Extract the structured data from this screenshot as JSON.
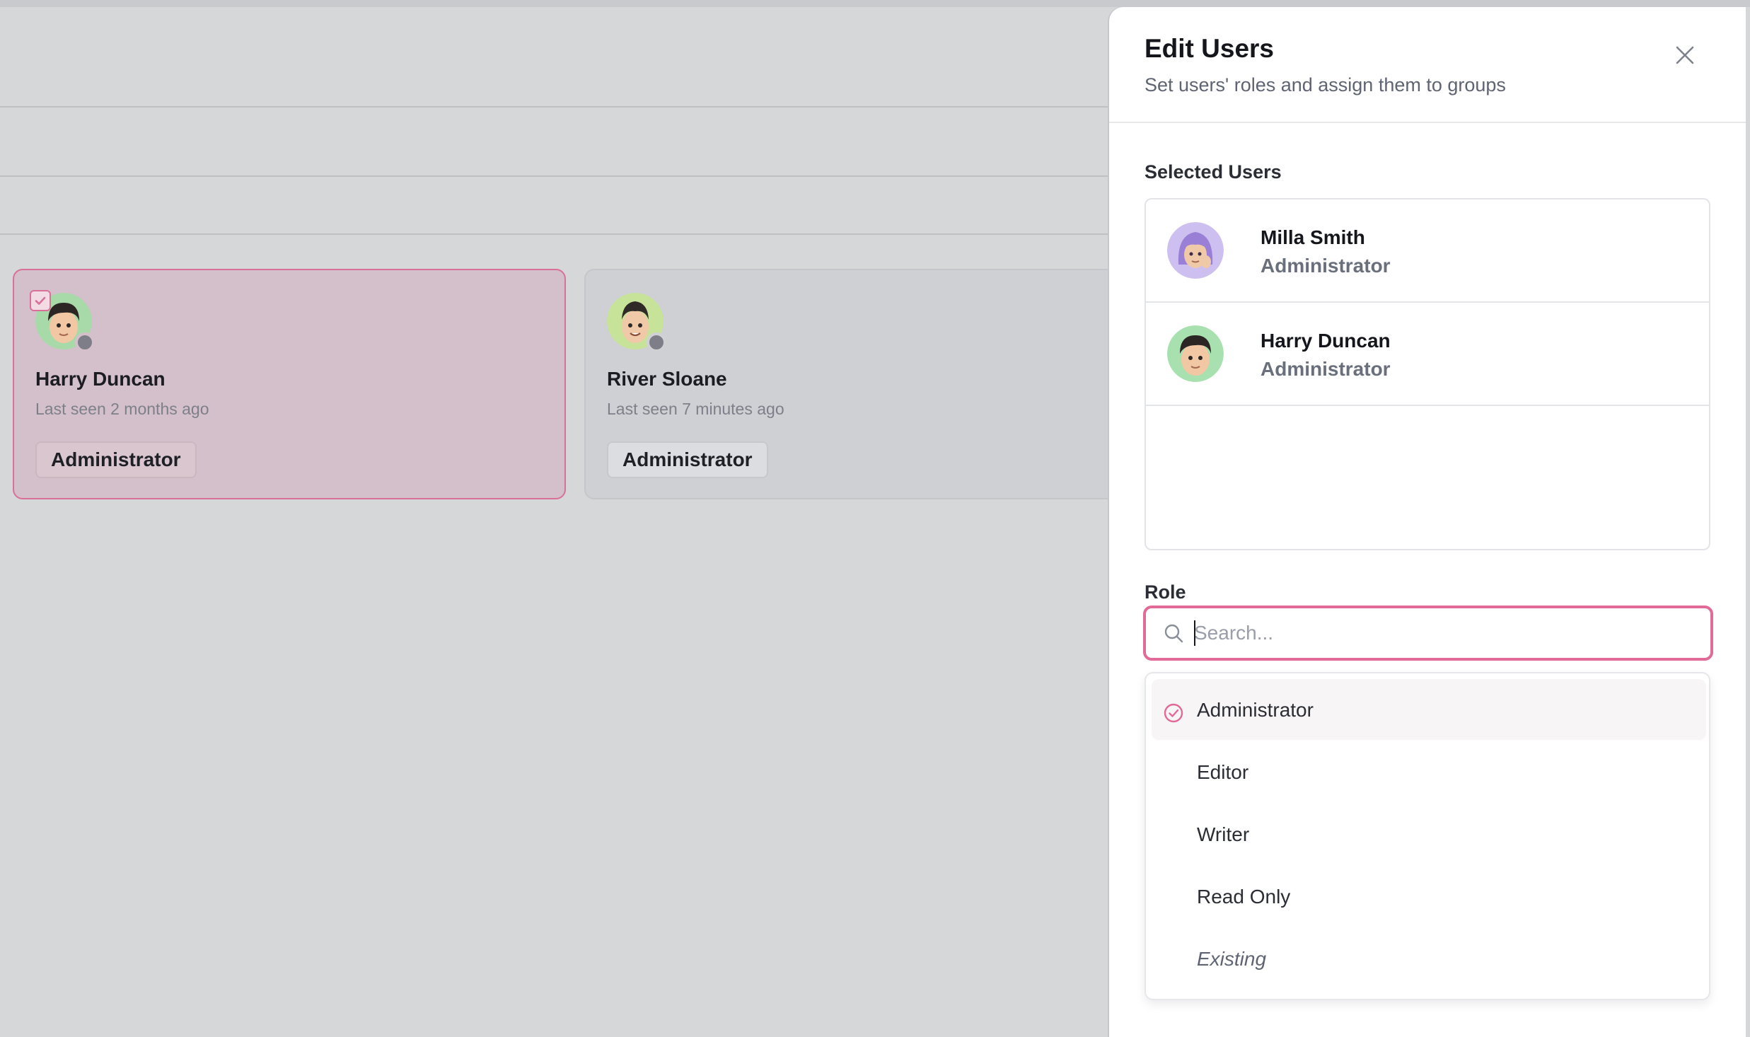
{
  "background": {
    "cards": [
      {
        "name": "Harry Duncan",
        "last_seen": "Last seen 2 months ago",
        "role": "Administrator",
        "selected": true
      },
      {
        "name": "River Sloane",
        "last_seen": "Last seen 7 minutes ago",
        "role": "Administrator",
        "selected": false
      }
    ]
  },
  "drawer": {
    "title": "Edit Users",
    "subtitle": "Set users' roles and assign them to groups",
    "close_icon": "close-icon",
    "selected_users_label": "Selected Users",
    "selected_users": [
      {
        "name": "Milla Smith",
        "role": "Administrator"
      },
      {
        "name": "Harry Duncan",
        "role": "Administrator"
      }
    ],
    "role_label": "Role",
    "role_search": {
      "placeholder": "Search...",
      "value": ""
    },
    "role_options": [
      {
        "label": "Administrator",
        "selected": true
      },
      {
        "label": "Editor",
        "selected": false
      },
      {
        "label": "Writer",
        "selected": false
      },
      {
        "label": "Read Only",
        "selected": false
      },
      {
        "label": "Existing",
        "selected": false
      }
    ]
  },
  "colors": {
    "accent": "#e26a98",
    "overlay_bg": "#d6d7d9",
    "selected_card_bg": "#d4c0ca"
  }
}
